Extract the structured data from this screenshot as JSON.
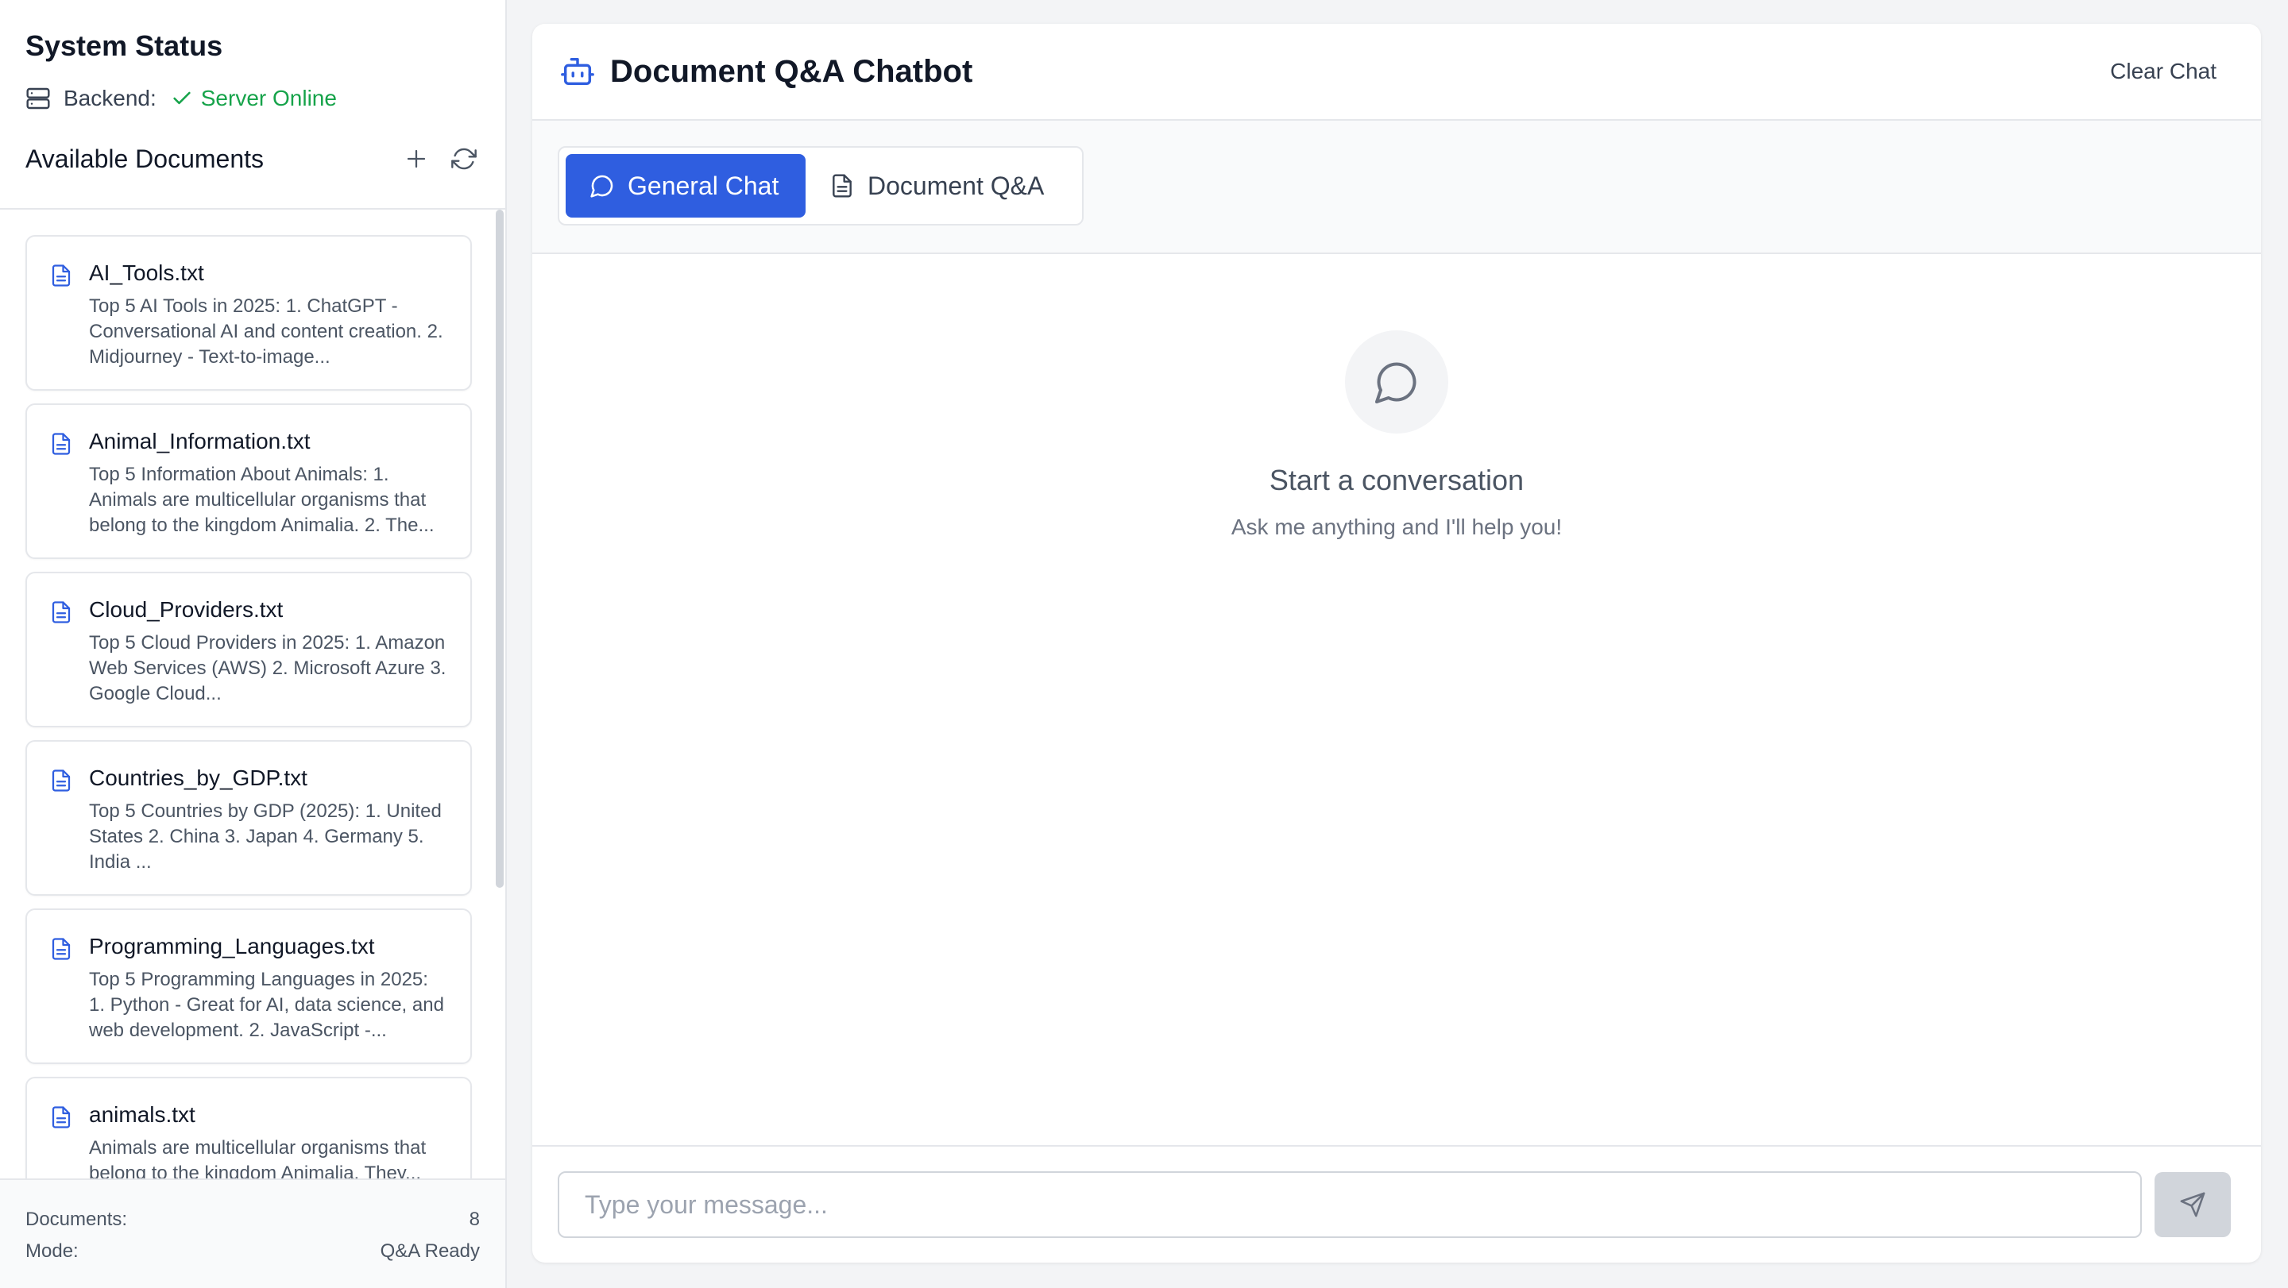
{
  "sidebar": {
    "title": "System Status",
    "backend_label": "Backend:",
    "backend_status": "Server Online",
    "documents_heading": "Available Documents",
    "documents": [
      {
        "name": "AI_Tools.txt",
        "preview": "Top 5 AI Tools in 2025: 1. ChatGPT - Conversational AI and content creation. 2. Midjourney - Text-to-image..."
      },
      {
        "name": "Animal_Information.txt",
        "preview": "Top 5 Information About Animals: 1. Animals are multicellular organisms that belong to the kingdom Animalia. 2. The..."
      },
      {
        "name": "Cloud_Providers.txt",
        "preview": "Top 5 Cloud Providers in 2025: 1. Amazon Web Services (AWS) 2. Microsoft Azure 3. Google Cloud..."
      },
      {
        "name": "Countries_by_GDP.txt",
        "preview": "Top 5 Countries by GDP (2025): 1. United States 2. China 3. Japan 4. Germany 5. India ..."
      },
      {
        "name": "Programming_Languages.txt",
        "preview": "Top 5 Programming Languages in 2025: 1. Python - Great for AI, data science, and web development. 2. JavaScript -..."
      },
      {
        "name": "animals.txt",
        "preview": "Animals are multicellular organisms that belong to the kingdom Animalia. They..."
      }
    ],
    "footer": {
      "documents_label": "Documents:",
      "documents_count": "8",
      "mode_label": "Mode:",
      "mode_value": "Q&A Ready"
    }
  },
  "header": {
    "title": "Document Q&A Chatbot",
    "clear_label": "Clear Chat"
  },
  "modes": {
    "general": "General Chat",
    "document": "Document Q&A"
  },
  "empty_state": {
    "title": "Start a conversation",
    "subtitle": "Ask me anything and I'll help you!"
  },
  "composer": {
    "placeholder": "Type your message...",
    "value": ""
  },
  "colors": {
    "accent": "#2f5ee0",
    "online": "#16a34a",
    "file_icon": "#2f5ee0"
  },
  "icons": {
    "backend": "server-icon",
    "status": "check-icon",
    "add": "plus-icon",
    "refresh": "refresh-icon",
    "document": "file-text-icon",
    "brand": "bot-icon",
    "general_mode": "message-circle-icon",
    "document_mode": "file-text-icon",
    "send": "send-icon"
  }
}
